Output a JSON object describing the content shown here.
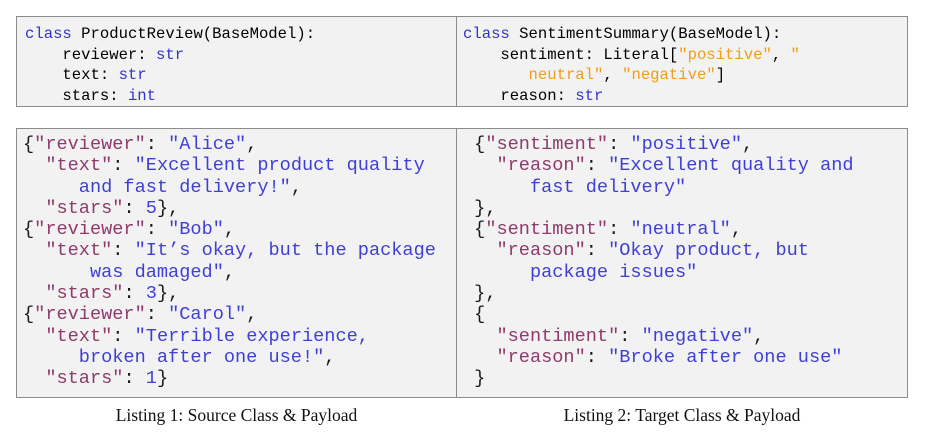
{
  "listing1": {
    "source_class": [
      "class ProductReview(BaseModel):",
      "    reviewer: str",
      "    text: str",
      "    stars: int"
    ],
    "payload": [
      "{\"reviewer\": \"Alice\",",
      "  \"text\": \"Excellent product quality",
      "     and fast delivery!\",",
      "  \"stars\": 5},",
      "{\"reviewer\": \"Bob\",",
      "  \"text\": \"It’s okay, but the package",
      "      was damaged\",",
      "  \"stars\": 3},",
      "{\"reviewer\": \"Carol\",",
      "  \"text\": \"Terrible experience,",
      "     broken after one use!\",",
      "  \"stars\": 1}"
    ],
    "caption": "Listing 1: Source Class & Payload"
  },
  "listing2": {
    "target_class": [
      "class SentimentSummary(BaseModel):",
      "    sentiment: Literal[\"positive\", \"",
      "       neutral\", \"negative\"]",
      "    reason: str"
    ],
    "payload": [
      " {\"sentiment\": \"positive\",",
      "   \"reason\": \"Excellent quality and",
      "      fast delivery\"",
      " },",
      " {\"sentiment\": \"neutral\",",
      "   \"reason\": \"Okay product, but",
      "      package issues\"",
      " },",
      " {",
      "   \"sentiment\": \"negative\",",
      "   \"reason\": \"Broke after one use\"",
      " }"
    ],
    "caption": "Listing 2: Target Class & Payload"
  }
}
